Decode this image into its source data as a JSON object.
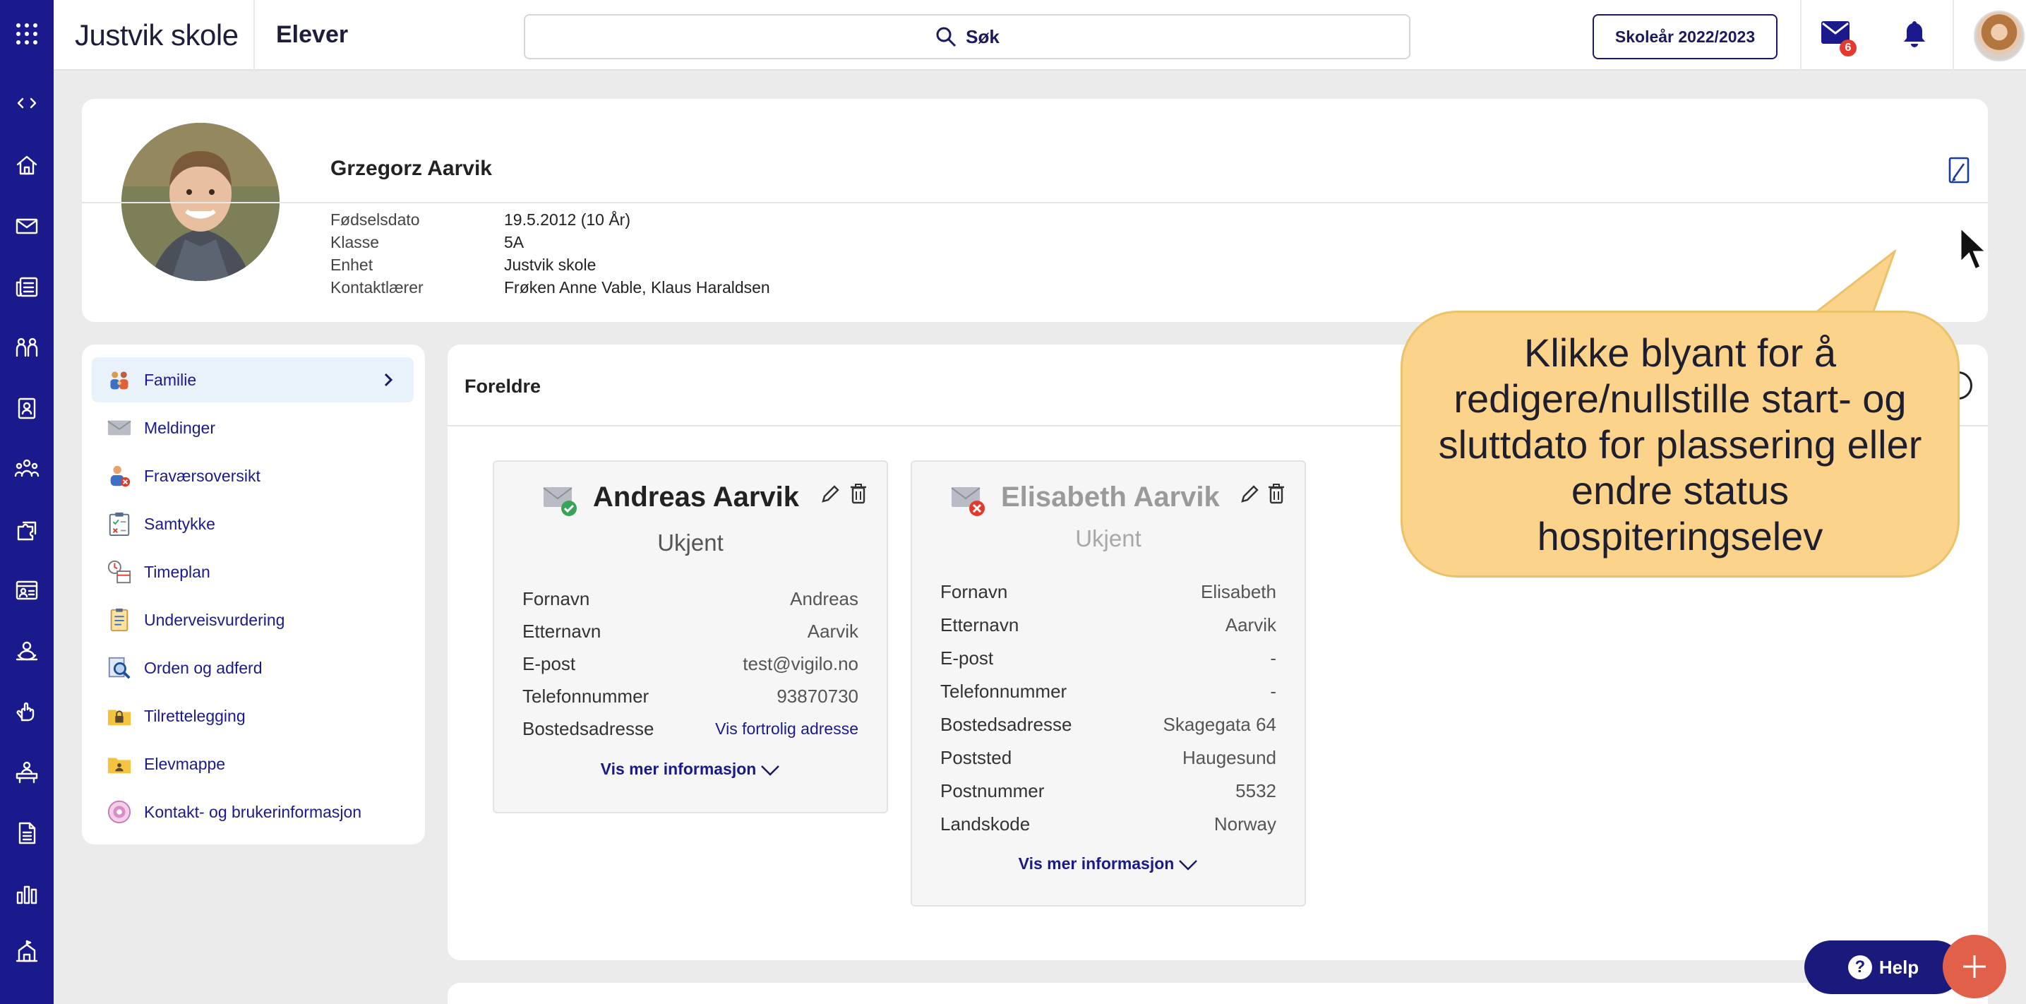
{
  "topbar": {
    "school_name": "Justvik skole",
    "section": "Elever",
    "search_label": "Søk",
    "school_year_button": "Skoleår 2022/2023",
    "mail_badge": "6"
  },
  "student": {
    "name": "Grzegorz Aarvik",
    "fields": [
      {
        "label": "Fødselsdato",
        "value": "19.5.2012 (10 År)"
      },
      {
        "label": "Klasse",
        "value": "5A"
      },
      {
        "label": "Enhet",
        "value": "Justvik skole"
      },
      {
        "label": "Kontaktlærer",
        "value": "Frøken Anne Vable, Klaus Haraldsen"
      }
    ]
  },
  "menu": {
    "items": [
      {
        "label": "Familie",
        "icon": "family-icon",
        "active": true
      },
      {
        "label": "Meldinger",
        "icon": "envelope-icon"
      },
      {
        "label": "Fraværsoversikt",
        "icon": "absence-icon"
      },
      {
        "label": "Samtykke",
        "icon": "clipboard-check-icon"
      },
      {
        "label": "Timeplan",
        "icon": "timetable-icon"
      },
      {
        "label": "Underveisvurdering",
        "icon": "assessment-icon"
      },
      {
        "label": "Orden og adferd",
        "icon": "magnifier-icon"
      },
      {
        "label": "Tilrettelegging",
        "icon": "lock-folder-icon"
      },
      {
        "label": "Elevmappe",
        "icon": "student-folder-icon"
      },
      {
        "label": "Kontakt- og brukerinformasjon",
        "icon": "contact-info-icon"
      }
    ]
  },
  "main": {
    "title": "Foreldre",
    "parents": [
      {
        "name": "Andreas Aarvik",
        "status": "Ukjent",
        "active": true,
        "fields": [
          {
            "label": "Fornavn",
            "value": "Andreas"
          },
          {
            "label": "Etternavn",
            "value": "Aarvik"
          },
          {
            "label": "E-post",
            "value": "test@vigilo.no"
          },
          {
            "label": "Telefonnummer",
            "value": "93870730"
          },
          {
            "label": "Bostedsadresse",
            "value": "Vis fortrolig adresse"
          }
        ],
        "more": "Vis mer informasjon"
      },
      {
        "name": "Elisabeth Aarvik",
        "status": "Ukjent",
        "active": false,
        "fields": [
          {
            "label": "Fornavn",
            "value": "Elisabeth"
          },
          {
            "label": "Etternavn",
            "value": "Aarvik"
          },
          {
            "label": "E-post",
            "value": "-"
          },
          {
            "label": "Telefonnummer",
            "value": "-"
          },
          {
            "label": "Bostedsadresse",
            "value": "Skagegata 64"
          },
          {
            "label": "Poststed",
            "value": "Haugesund"
          },
          {
            "label": "Postnummer",
            "value": "5532"
          },
          {
            "label": "Landskode",
            "value": "Norway"
          }
        ],
        "more": "Vis mer informasjon"
      }
    ]
  },
  "tooltip": {
    "lines": [
      "Klikke blyant for å",
      "redigere/nullstille start- og",
      "sluttdato for plassering eller",
      "endre status",
      "hospiteringselev"
    ]
  },
  "help_button": "Help",
  "colors": {
    "rail": "#1a1a8c",
    "accent": "#1a1a8c",
    "tooltip": "#fcd38a",
    "fab": "#e0604a"
  }
}
